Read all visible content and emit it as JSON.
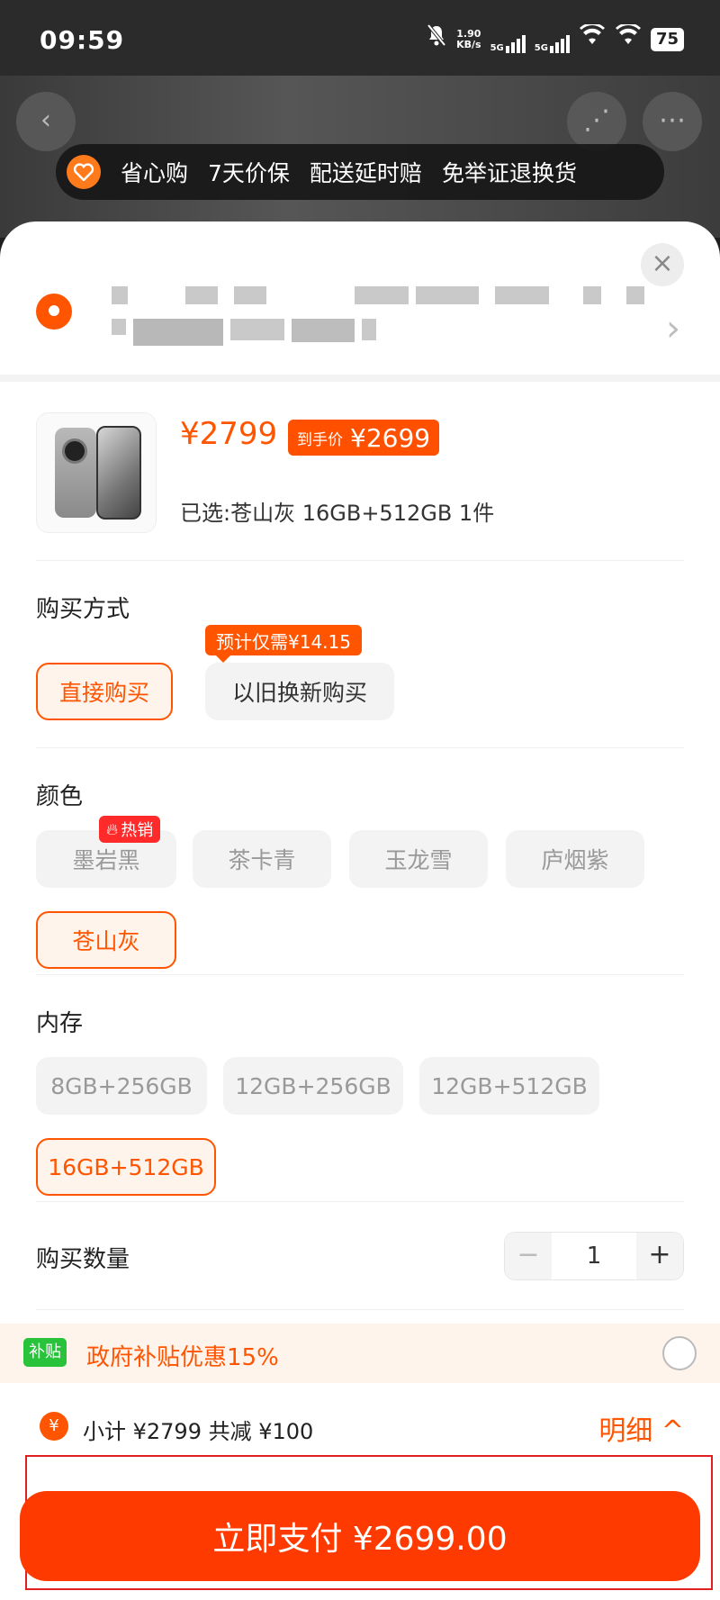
{
  "status_bar": {
    "time": "09:59",
    "net_speed_value": "1.90",
    "net_speed_unit": "KB/s",
    "sim1": "5G",
    "sim2": "5G",
    "battery": "75"
  },
  "background": {
    "guarantee_items": [
      "省心购",
      "7天价保",
      "配送延时赔",
      "免举证退换货"
    ]
  },
  "product": {
    "price": "¥2799",
    "final_price_label": "到手价",
    "final_price": "¥2699",
    "selected": "已选:苍山灰  16GB+512GB  1件"
  },
  "purchase_method": {
    "title": "购买方式",
    "options": [
      "直接购买",
      "以旧换新购买"
    ],
    "selected": "直接购买",
    "tradein_tip": "预计仅需¥14.15"
  },
  "color": {
    "title": "颜色",
    "hot_label": "热销",
    "options": [
      "墨岩黑",
      "茶卡青",
      "玉龙雪",
      "庐烟紫",
      "苍山灰"
    ],
    "selected": "苍山灰"
  },
  "memory": {
    "title": "内存",
    "options": [
      "8GB+256GB",
      "12GB+256GB",
      "12GB+512GB",
      "16GB+512GB"
    ],
    "selected": "16GB+512GB"
  },
  "quantity": {
    "title": "购买数量",
    "value": "1",
    "minus": "−",
    "plus": "+"
  },
  "subsidy": {
    "tag": "补贴",
    "text": "政府补贴优惠15%"
  },
  "summary": {
    "text": "小计 ¥2799  共减 ¥100",
    "detail": "明细 ^"
  },
  "pay_button": "立即支付 ¥2699.00",
  "colors": {
    "accent": "#ff5500",
    "pay_button": "#ff3a00",
    "subsidy_tag": "#29c23b"
  }
}
